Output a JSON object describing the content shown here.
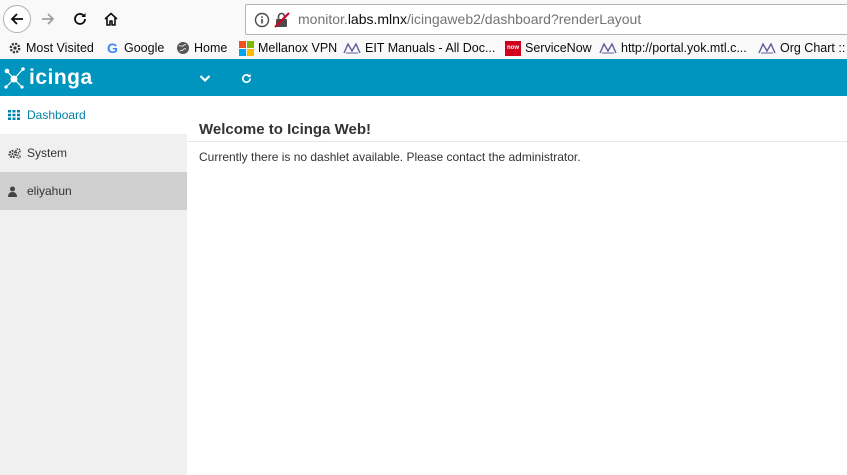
{
  "browser": {
    "url_prefix": "monitor.",
    "url_host": "labs.mlnx",
    "url_path": "/icingaweb2/dashboard?renderLayout"
  },
  "bookmarks": [
    {
      "label": "Most Visited",
      "icon": "gear-icon"
    },
    {
      "label": "Google",
      "icon": "google-icon"
    },
    {
      "label": "Home",
      "icon": "globe-icon"
    },
    {
      "label": "Mellanox VPN",
      "icon": "microsoft-icon"
    },
    {
      "label": "EIT Manuals - All Doc...",
      "icon": "mellanox-icon"
    },
    {
      "label": "ServiceNow",
      "icon": "servicenow-icon"
    },
    {
      "label": "http://portal.yok.mtl.c...",
      "icon": "mellanox-icon"
    },
    {
      "label": "Org Chart :: I",
      "icon": "mellanox-icon"
    }
  ],
  "app": {
    "logo_text": "icinga",
    "brand_color": "#0095bf"
  },
  "sidebar": {
    "items": [
      {
        "label": "Dashboard",
        "icon": "grid-icon",
        "active": true
      },
      {
        "label": "System",
        "icon": "gears-icon"
      },
      {
        "label": "eliyahun",
        "icon": "user-icon"
      }
    ]
  },
  "main": {
    "title": "Welcome to Icinga Web!",
    "message": "Currently there is no dashlet available. Please contact the administrator."
  }
}
